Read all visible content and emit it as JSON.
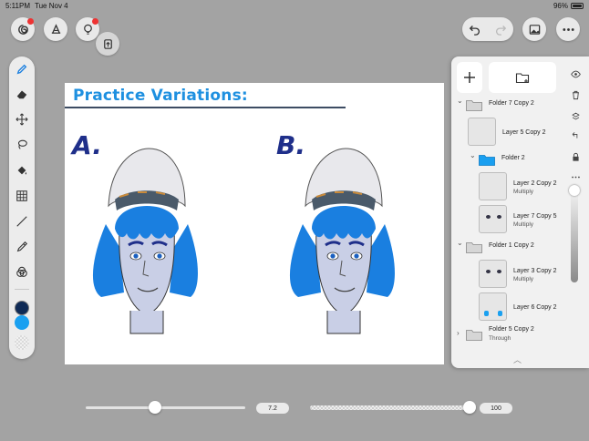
{
  "status": {
    "time": "5:11PM",
    "date": "Tue Nov 4",
    "battery": "96%"
  },
  "canvas": {
    "title": "Practice Variations:",
    "title_color": "#1e90e0",
    "variant_a": "A.",
    "variant_b": "B.",
    "label_color": "#1f2f8a"
  },
  "colors": {
    "primary": "#0f2a55",
    "secondary": "#1aa0f0",
    "hair": "#1a7fe0"
  },
  "layers": [
    {
      "kind": "folder",
      "name": "Folder 7 Copy 2",
      "mode": "",
      "expanded": true
    },
    {
      "kind": "layer",
      "name": "Layer 5 Copy 2",
      "mode": ""
    },
    {
      "kind": "folder",
      "name": "Folder 2",
      "mode": "",
      "expanded": true,
      "highlight": true
    },
    {
      "kind": "layer",
      "name": "Layer 2 Copy 2",
      "mode": "Multiply"
    },
    {
      "kind": "layer",
      "name": "Layer 7 Copy 5",
      "mode": "Multiply"
    },
    {
      "kind": "folder",
      "name": "Folder 1 Copy 2",
      "mode": "",
      "expanded": true
    },
    {
      "kind": "layer",
      "name": "Layer 3 Copy 2",
      "mode": "Multiply"
    },
    {
      "kind": "layer",
      "name": "Layer 6 Copy 2",
      "mode": ""
    },
    {
      "kind": "folder",
      "name": "Folder 5 Copy 2",
      "mode": "Through",
      "expanded": false
    }
  ],
  "brush": {
    "size_label": "7.2",
    "size_fraction": 0.42,
    "opacity_label": "100",
    "opacity_fraction": 1.0
  },
  "icons": {
    "top_left": [
      "swirl-icon",
      "brush-library-icon",
      "lightbulb-icon",
      "transform-icon"
    ],
    "top_right": [
      "undo-icon",
      "redo-icon",
      "image-icon",
      "more-icon"
    ],
    "tools": [
      "pen-icon",
      "eraser-icon",
      "move-icon",
      "lasso-icon",
      "fill-icon",
      "grid-icon",
      "line-icon",
      "eyedropper-icon",
      "blend-icon"
    ],
    "layer_side": [
      "eye-icon",
      "trash-icon",
      "layers-merge-icon",
      "clip-icon",
      "lock-icon",
      "more-icon"
    ]
  }
}
